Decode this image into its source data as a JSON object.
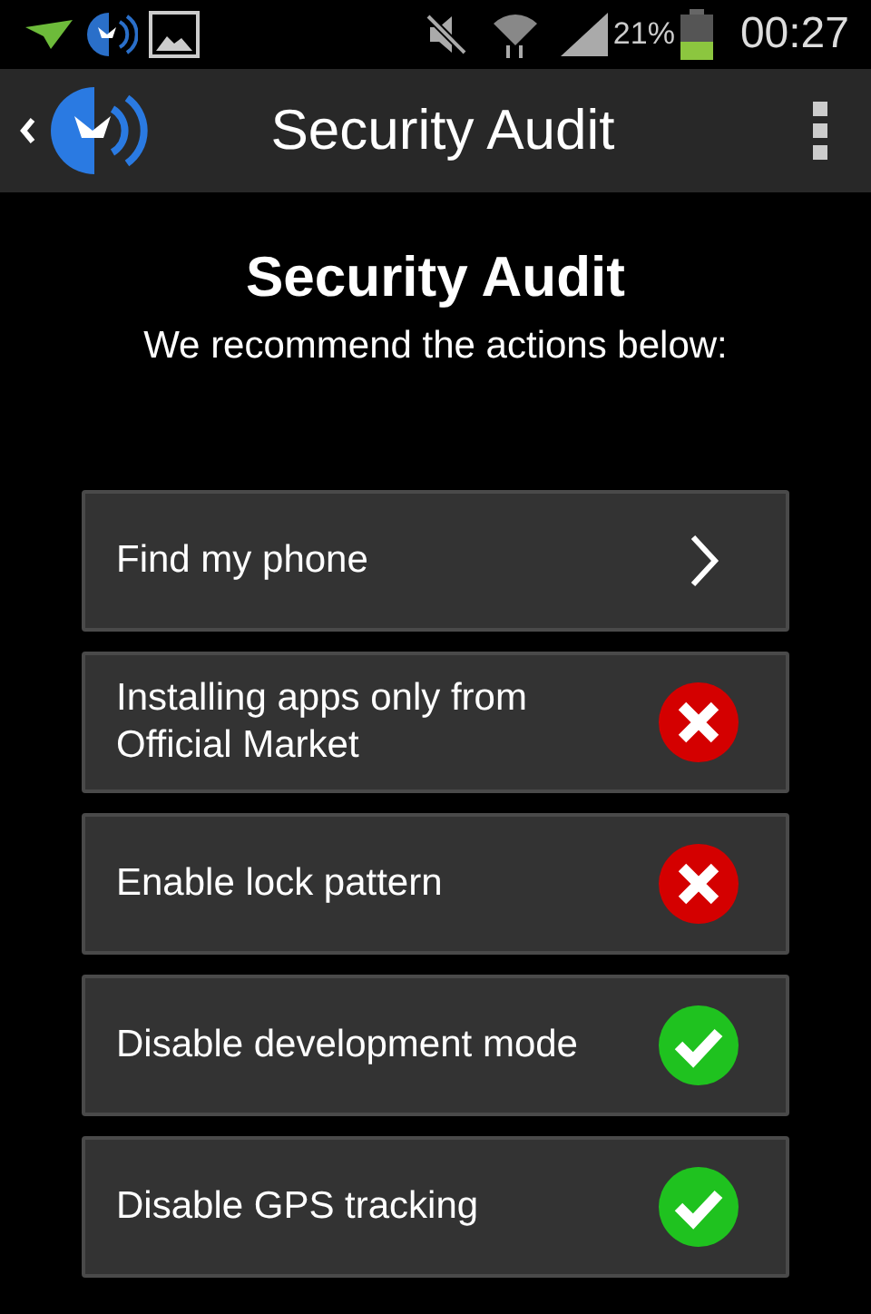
{
  "status_bar": {
    "battery": "21%",
    "time": "00:27"
  },
  "app_bar": {
    "title": "Security Audit"
  },
  "heading": "Security Audit",
  "subtitle": "We recommend the actions below:",
  "items": [
    {
      "label": "Find my phone",
      "kind": "link"
    },
    {
      "label": "Installing apps only from Official Market",
      "kind": "fail"
    },
    {
      "label": "Enable lock pattern",
      "kind": "fail"
    },
    {
      "label": "Disable development mode",
      "kind": "pass"
    },
    {
      "label": "Disable GPS tracking",
      "kind": "pass"
    }
  ]
}
